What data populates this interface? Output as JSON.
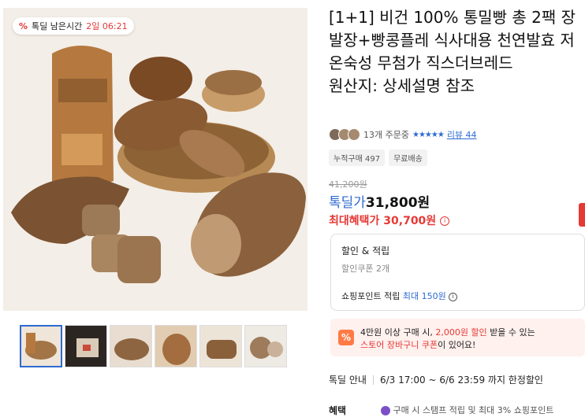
{
  "timer": {
    "pct_icon": "%",
    "label": "톡딜 남은시간",
    "time": "2일 06:21"
  },
  "product": {
    "title": "[1+1] 비건 100% 통밀빵 총 2팩 장발장+빵콩플레 식사대용 천연발효 저온숙성 무첨가 직스더브레드",
    "origin": "원산지: 상세설명 참조"
  },
  "meta": {
    "orders": "13개 주문중",
    "stars": "★★★★★",
    "review": "리뷰 44"
  },
  "badges": [
    "누적구매 497",
    "무료배송"
  ],
  "pricing": {
    "original": "41,200원",
    "label": "톡딜가",
    "price": "31,800원",
    "max_benefit": "최대혜택가 30,700원"
  },
  "discount_box": {
    "heading": "할인 & 적립",
    "coupon_line": "할인쿠폰 2개",
    "points_prefix": "쇼핑포인트 적립",
    "points_value": "최대 150원"
  },
  "coupon_banner": {
    "line1_a": "4만원 이상 구매 시,",
    "line1_b": "2,000원 할인",
    "line1_c": "받을 수 있는",
    "line2_a": "스토어 장바구니 쿠폰",
    "line2_b": "이 있어요!"
  },
  "deal": {
    "label": "톡딜 안내",
    "period": "6/3 17:00 ~ 6/6 23:59 까지 한정할인"
  },
  "benefit": {
    "label": "혜택",
    "text": "구매 시 스탬프 적립 및 최대 3% 쇼핑포인트"
  },
  "colors": {
    "accent": "#2e6ad1",
    "sale": "#e53935",
    "coupon_bg": "#fff1ee"
  },
  "icons": {
    "timer": "percent-tag-icon",
    "info": "info-circle-icon",
    "coupon": "percent-coupon-icon"
  }
}
